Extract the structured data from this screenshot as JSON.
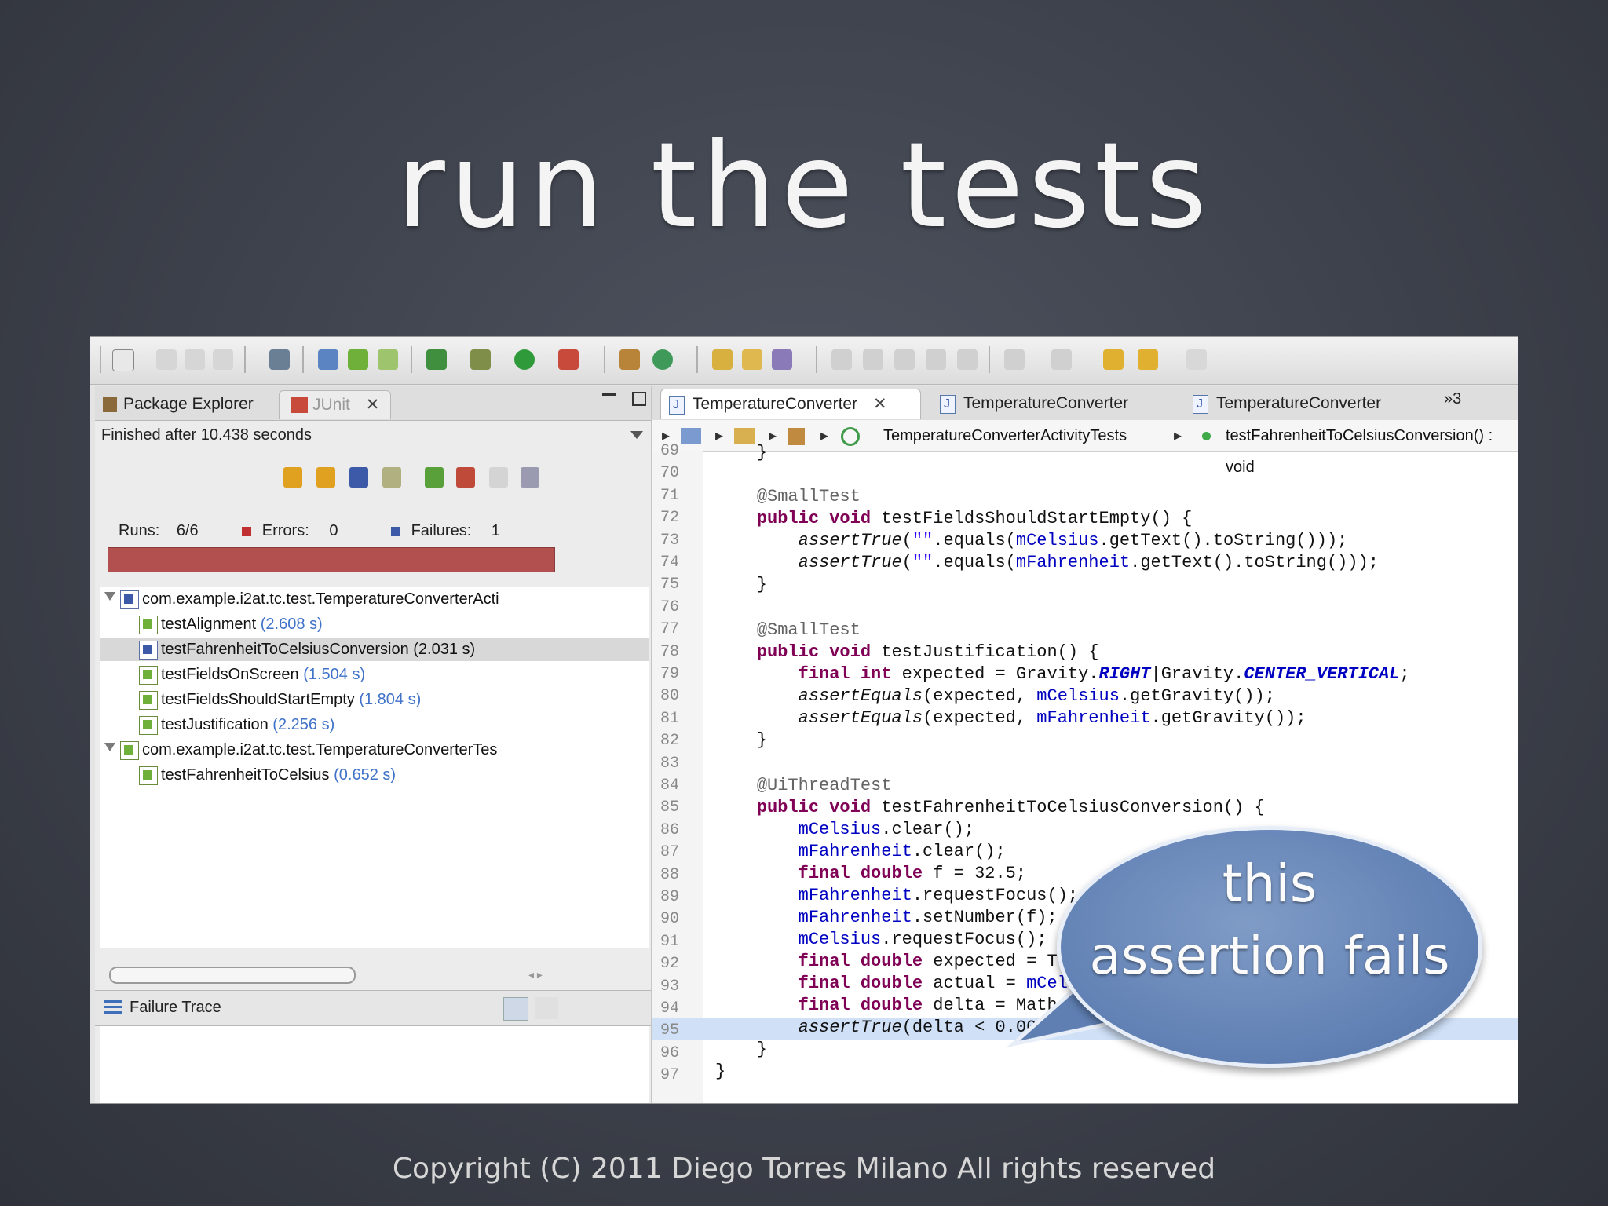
{
  "slide": {
    "title": "run the tests",
    "copyright": "Copyright (C) 2011  Diego Torres Milano  All rights reserved"
  },
  "left_panel": {
    "tabs": [
      "Package Explorer",
      "JUnit"
    ],
    "status": "Finished after 10.438 seconds",
    "runs_label": "Runs:",
    "runs_value": "6/6",
    "errors_label": "Errors:",
    "errors_value": "0",
    "failures_label": "Failures:",
    "failures_value": "1",
    "bar_color": "#b24f4f",
    "tree": [
      {
        "name": "com.example.i2at.tc.test.TemperatureConverterActi",
        "time": ""
      },
      {
        "name": "testAlignment",
        "time": "(2.608 s)"
      },
      {
        "name": "testFahrenheitToCelsiusConversion (2.031 s)",
        "time": ""
      },
      {
        "name": "testFieldsOnScreen",
        "time": "(1.504 s)"
      },
      {
        "name": "testFieldsShouldStartEmpty",
        "time": "(1.804 s)"
      },
      {
        "name": "testJustification",
        "time": "(2.256 s)"
      },
      {
        "name": "com.example.i2at.tc.test.TemperatureConverterTes",
        "time": ""
      },
      {
        "name": "testFahrenheitToCelsius",
        "time": "(0.652 s)"
      }
    ],
    "failure_trace": "Failure Trace"
  },
  "editor": {
    "tabs": [
      "TemperatureConverter",
      "TemperatureConverter",
      "TemperatureConverter"
    ],
    "overflow": "»3",
    "breadcrumb_class": "TemperatureConverterActivityTests",
    "breadcrumb_method": "testFahrenheitToCelsiusConversion() : void",
    "line_numbers": [
      "69",
      "70",
      "71",
      "72",
      "73",
      "74",
      "75",
      "76",
      "77",
      "78",
      "79",
      "80",
      "81",
      "82",
      "83",
      "84",
      "85",
      "86",
      "87",
      "88",
      "89",
      "90",
      "91",
      "92",
      "93",
      "94",
      "95",
      "96",
      "97"
    ],
    "highlighted_line": "95"
  },
  "callout": {
    "line1": "this",
    "line2": "assertion fails"
  }
}
